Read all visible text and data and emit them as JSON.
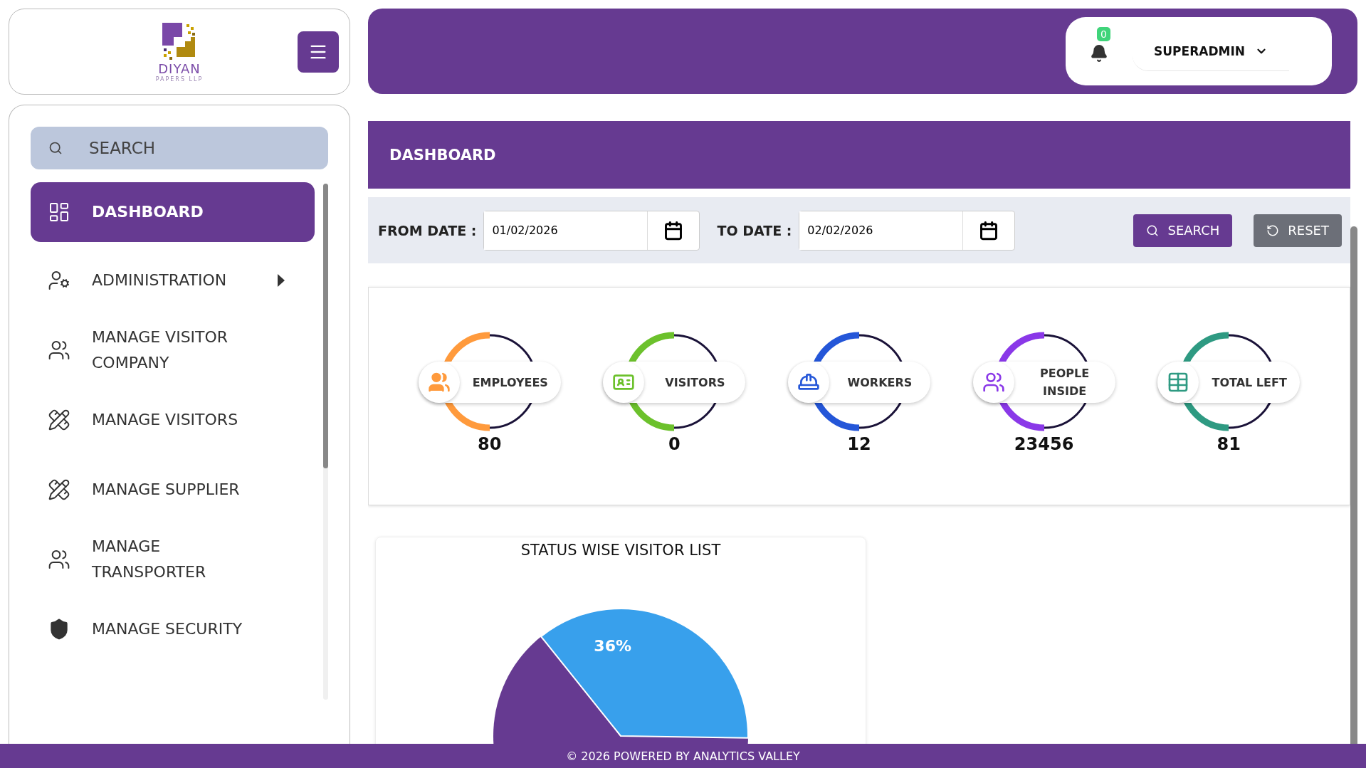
{
  "logo": {
    "name": "DIYAN",
    "tagline": "PAPERS LLP"
  },
  "header": {
    "notification_count": "0",
    "user": "SUPERADMIN"
  },
  "sidebar": {
    "search_placeholder": "SEARCH",
    "items": [
      {
        "label": "DASHBOARD",
        "selected": true,
        "has_submenu": false
      },
      {
        "label": "ADMINISTRATION",
        "selected": false,
        "has_submenu": true
      },
      {
        "label": "MANAGE VISITOR COMPANY",
        "selected": false,
        "has_submenu": false
      },
      {
        "label": "MANAGE VISITORS",
        "selected": false,
        "has_submenu": false
      },
      {
        "label": "MANAGE SUPPLIER",
        "selected": false,
        "has_submenu": false
      },
      {
        "label": "MANAGE TRANSPORTER",
        "selected": false,
        "has_submenu": false
      },
      {
        "label": "MANAGE SECURITY",
        "selected": false,
        "has_submenu": false
      }
    ]
  },
  "page_title": "DASHBOARD",
  "filters": {
    "from_label": "FROM DATE :",
    "from_value": "01/02/2026",
    "to_label": "TO DATE :",
    "to_value": "02/02/2026",
    "search_button": "SEARCH",
    "reset_button": "RESET"
  },
  "stats": [
    {
      "label": "EMPLOYEES",
      "value": "80",
      "color": "#ff9a3c"
    },
    {
      "label": "VISITORS",
      "value": "0",
      "color": "#6cc12c"
    },
    {
      "label": "WORKERS",
      "value": "12",
      "color": "#2456d8"
    },
    {
      "label": "PEOPLE INSIDE",
      "value": "23456",
      "color": "#8a38e8"
    },
    {
      "label": "TOTAL LEFT",
      "value": "81",
      "color": "#2e9a82"
    }
  ],
  "chart": {
    "title": "STATUS WISE VISITOR LIST",
    "slices": [
      {
        "label": "36%",
        "color": "#38a0ec"
      },
      {
        "color": "#663a91"
      }
    ]
  },
  "footer": "© 2026 POWERED BY ANALYTICS VALLEY"
}
